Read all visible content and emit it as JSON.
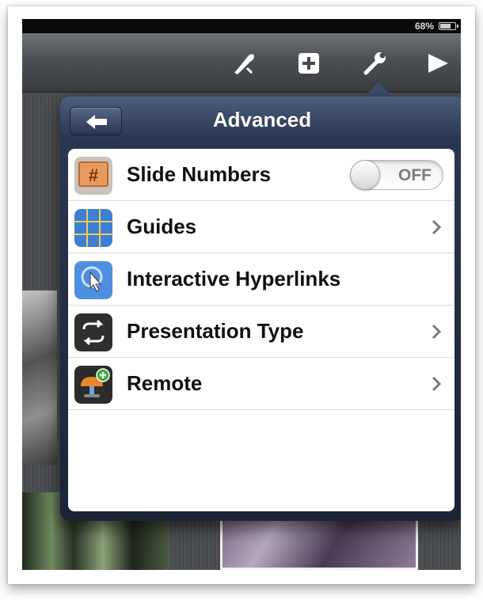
{
  "statusbar": {
    "battery_text": "68%",
    "battery_level": 0.68
  },
  "toolbar": {
    "icons": [
      "paintbrush-icon",
      "add-icon",
      "wrench-icon",
      "play-icon"
    ]
  },
  "popover": {
    "title": "Advanced",
    "back_icon": "back-arrow-icon",
    "items": [
      {
        "label": "Slide Numbers",
        "icon": "slide-numbers-icon",
        "control": "toggle",
        "toggle_text": "OFF"
      },
      {
        "label": "Guides",
        "icon": "guides-icon",
        "control": "chevron"
      },
      {
        "label": "Interactive Hyperlinks",
        "icon": "hyperlinks-icon",
        "control": "none"
      },
      {
        "label": "Presentation Type",
        "icon": "presentation-type-icon",
        "control": "chevron"
      },
      {
        "label": "Remote",
        "icon": "remote-icon",
        "control": "chevron"
      }
    ]
  },
  "colors": {
    "popover_header": "#2a3650",
    "toggle_off_text": "#7d7d7d"
  }
}
